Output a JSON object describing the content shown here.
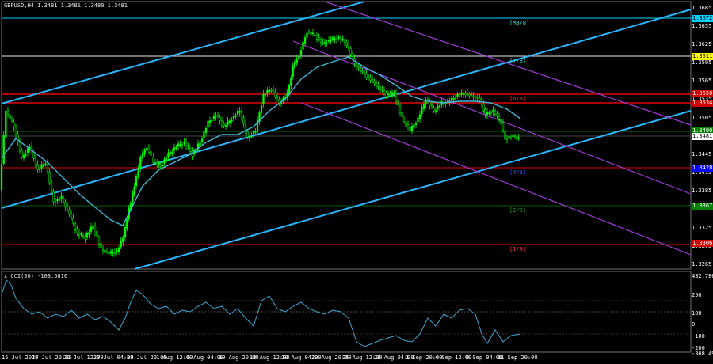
{
  "header": {
    "symbol_line": "GBPUSD,H4  1.3481 1.3481 1.3480 1.3481",
    "indicator_line": "x_CCI(30) -103.5816"
  },
  "price_axis": [
    "1.3685",
    "1.3655",
    "1.3625",
    "1.3595",
    "1.3565",
    "1.3535",
    "1.3505",
    "1.3475",
    "1.3445",
    "1.3415",
    "1.3385",
    "1.3355",
    "1.3325",
    "1.3295",
    "1.3265"
  ],
  "cci_axis": [
    "432.786",
    "250",
    "100",
    "0",
    "-100",
    "-200",
    "-368.497"
  ],
  "time_axis": [
    "15 Jul 2026",
    "17 Jul 20:00",
    "22 Jul 12:00",
    "27 Jul 04:00",
    "29 Jul 20:00",
    "1 Aug 12:00",
    "6 Aug 04:00",
    "10 Aug 20:00",
    "13 Aug 12:00",
    "18 Aug 04:00",
    "20 Aug 20:00",
    "25 Aug 12:00",
    "28 Aug 04:00",
    "1 Sep 20:00",
    "4 Sep 12:00",
    "9 Sep 04:00",
    "11 Sep 20:00"
  ],
  "price_tags": [
    {
      "text": "1.3672",
      "bg": "#00cfff",
      "fg": "#000"
    },
    {
      "text": "1.3611",
      "bg": "#ffff00",
      "fg": "#000"
    },
    {
      "text": "1.3550",
      "bg": "#d00000",
      "fg": "#fff"
    },
    {
      "text": "1.3534",
      "bg": "#d00000",
      "fg": "#fff"
    },
    {
      "text": "1.3490",
      "bg": "#008000",
      "fg": "#fff"
    },
    {
      "text": "1.3481",
      "bg": "#ffffff",
      "fg": "#000"
    },
    {
      "text": "1.3428",
      "bg": "#0000ff",
      "fg": "#fff"
    },
    {
      "text": "1.3367",
      "bg": "#008000",
      "fg": "#fff"
    },
    {
      "text": "1.3306",
      "bg": "#d00000",
      "fg": "#fff"
    }
  ],
  "level_labels": [
    {
      "text": "[M8/8]",
      "color": "#40e0d0"
    },
    {
      "text": "[7/8]",
      "color": "#40e0d0"
    },
    {
      "text": "[6/8]",
      "color": "#ff3030"
    },
    {
      "text": "[4/8]",
      "color": "#3050ff"
    },
    {
      "text": "[2/8]",
      "color": "#20a020"
    },
    {
      "text": "[1/8]",
      "color": "#ff3030"
    }
  ],
  "colors": {
    "candle": "#00ff00",
    "channel": "#2ab5ff",
    "channel2": "#9f3bd6",
    "ma": "#3fb8d8",
    "level_red": "#e00000",
    "cci": "#3ea7d1"
  }
}
